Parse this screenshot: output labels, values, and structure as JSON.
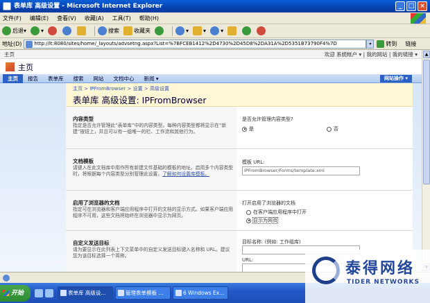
{
  "window": {
    "title": "表单库 高级设置 - Microsoft Internet Explorer",
    "controls": [
      "_",
      "□",
      "×"
    ]
  },
  "menu": [
    "文件(F)",
    "编辑(E)",
    "查看(V)",
    "收藏(A)",
    "工具(T)",
    "帮助(H)"
  ],
  "toolbar": {
    "back": "后退",
    "search": "搜索",
    "favorites": "收藏夹"
  },
  "address": {
    "label": "地址(D)",
    "url": "http://lt:8080/sites/home/_layouts/advsetng.aspx?List=%7BFCEB1412%2D4730%2D45D8%2DA31A%2D5351B73790F4%7D",
    "go": "转到",
    "links": "链接"
  },
  "sp": {
    "home": "主页",
    "welcome": "欢迎 系统帐户 ▾",
    "my_site": "我的网站",
    "my_links": "我的链接 ▾"
  },
  "site": {
    "title": "主页"
  },
  "nav": {
    "tabs": [
      "主页",
      "报告",
      "表单库",
      "搜索",
      "网站",
      "文档中心",
      "新闻 ▾"
    ],
    "site_actions": "网站操作 ▾"
  },
  "page": {
    "breadcrumb": "主页 > IPFromBrowser > 设置 > 高级设置",
    "title": "表单库 高级设置: IPFromBrowser"
  },
  "sections": {
    "content_types": {
      "heading": "内容类型",
      "desc": "指定是否允许管理此“表单库”中的内容类型。每种内容类型都将显示在“新建”按钮上，并且可以有一组唯一的栏、工作流和其他行为。",
      "question": "是否允许管理内容类型?",
      "yes": "是",
      "no": "否"
    },
    "template": {
      "heading": "文档模板",
      "desc": "请键入在此文档库中用作所有新建文件基础的模板的地址。启用多个内容类型时，将根据每个内容类型分别管理此设置。",
      "desc_link": "了解如何设置库模板。",
      "label": "模板 URL:",
      "value": "IPFromBrowser/Forms/template.xml"
    },
    "browser": {
      "heading": "启用了浏览器的文档",
      "desc": "指定可在浏览器和客户端应用程序中打开的文档的显示方式。如果客户端应用程序不可用，这些文档将始终在浏览器中显示为网页。",
      "question": "打开启用了浏览器的文档",
      "opt1": "在客户端应用程序中打开",
      "opt2": "显示为网页"
    },
    "send_to": {
      "heading": "自定义发送目标",
      "desc": "请为要显示在此列表上下文菜单中的自定义发送目标键入名称和 URL。建议您为该目标选择一个简称。",
      "name_label": "目标名称: (例如: 工作组库)",
      "url_label": "URL:"
    }
  },
  "taskbar": {
    "start": "开始",
    "tasks": [
      "表单库 高级设...",
      "管理表单模板 ...",
      "6 Windows Ex..."
    ]
  },
  "watermark": {
    "cn": "泰得网络",
    "en": "TIDER NETWORKS"
  }
}
